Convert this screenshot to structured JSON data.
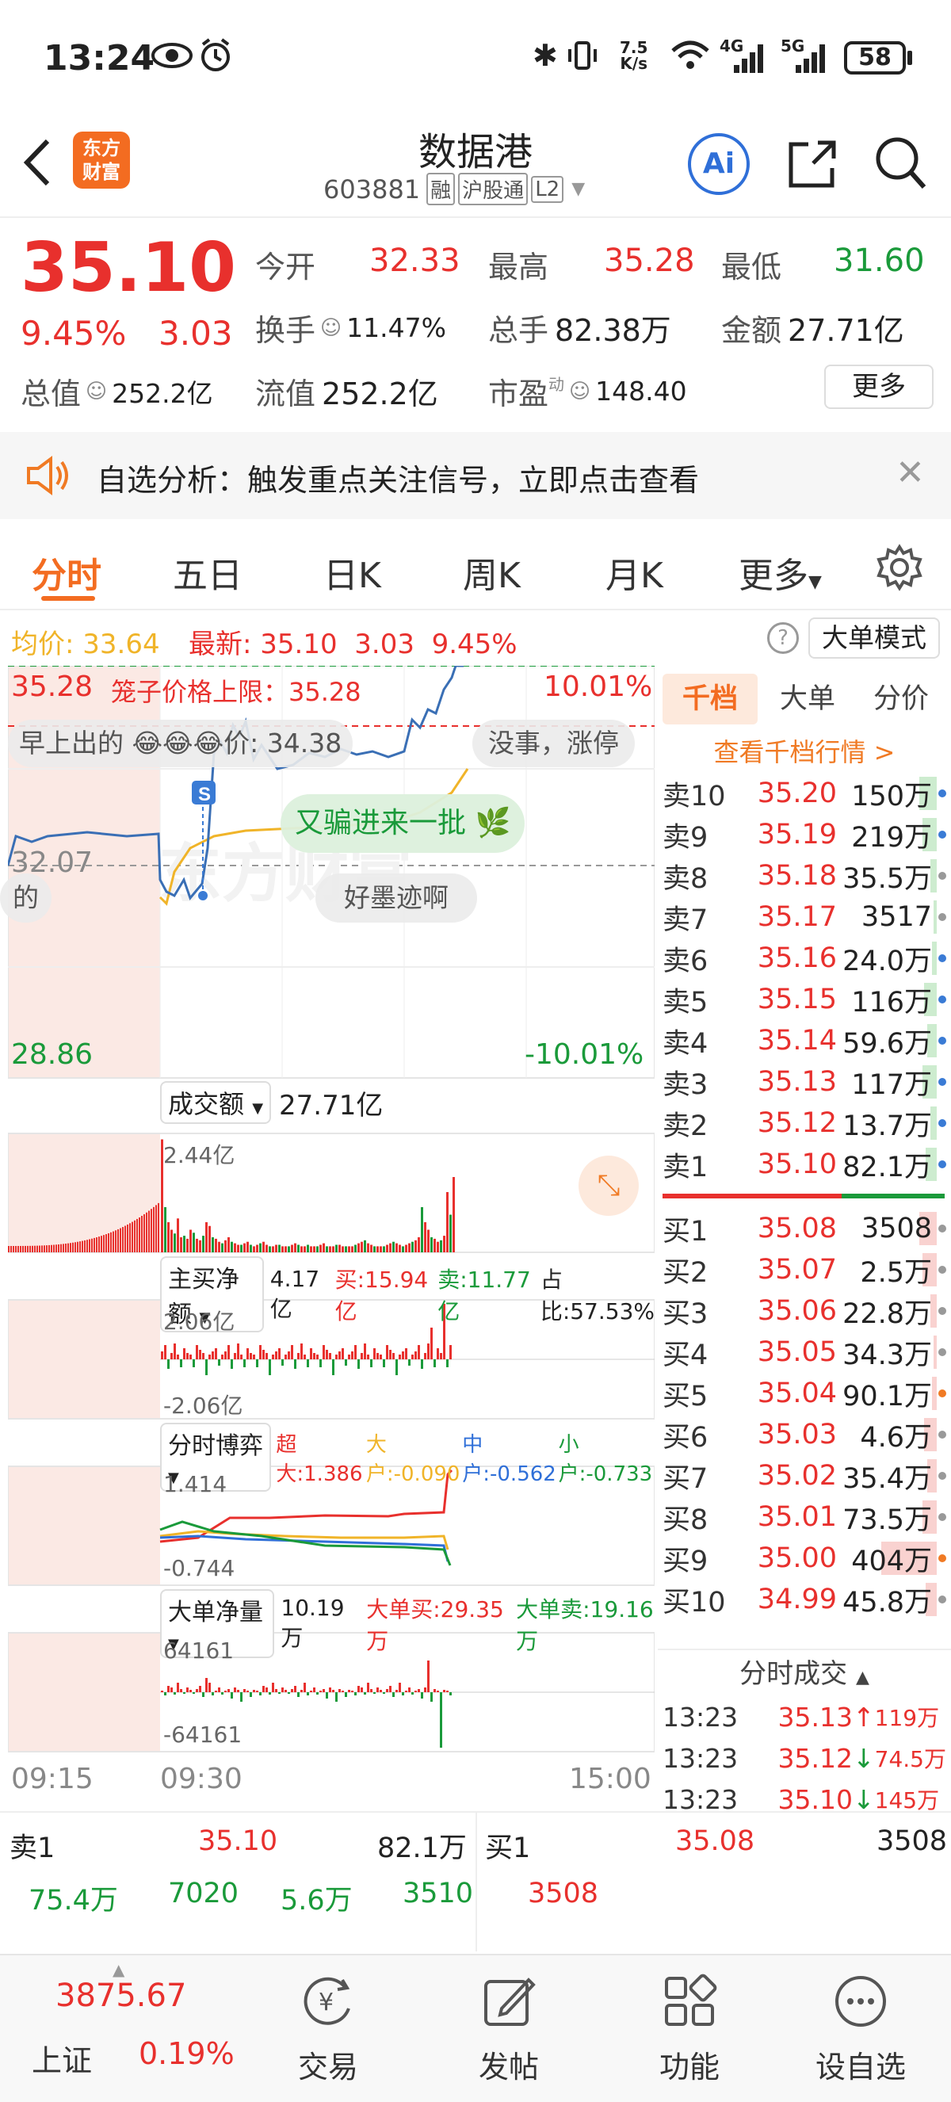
{
  "status": {
    "time": "13:24",
    "net_speed_top": "7.5",
    "net_speed_bottom": "K/s",
    "net1": "4G",
    "net2": "5G",
    "battery": "58"
  },
  "header": {
    "logo_line1": "东方",
    "logo_line2": "财富",
    "title": "数据港",
    "code": "603881",
    "badge1": "融",
    "badge2": "沪股通",
    "badge3": "L2",
    "ai_label": "Ai"
  },
  "quote": {
    "price": "35.10",
    "change_pct": "9.45%",
    "change": "3.03",
    "open_label": "今开",
    "open": "32.33",
    "high_label": "最高",
    "high": "35.28",
    "low_label": "最低",
    "low": "31.60",
    "turnover_label": "换手",
    "turnover": "11.47%",
    "volume_label": "总手",
    "volume": "82.38万",
    "amount_label": "金额",
    "amount": "27.71亿",
    "mktcap_label": "总值",
    "mktcap": "252.2亿",
    "float_label": "流值",
    "float": "252.2亿",
    "pe_label": "市盈",
    "pe_sup": "动",
    "pe": "148.40",
    "more_btn": "更多"
  },
  "notice": {
    "text": "自选分析：触发重点关注信号，立即点击查看"
  },
  "tabs": [
    "分时",
    "五日",
    "日K",
    "周K",
    "月K",
    "更多"
  ],
  "infoline": {
    "avg_label": "均价:",
    "avg": "33.64",
    "latest_label": "最新:",
    "latest": "35.10",
    "chg": "3.03",
    "pct": "9.45%",
    "mode_btn": "大单模式"
  },
  "chart": {
    "top_price": "35.28",
    "limit_text": "笼子价格上限：35.28",
    "top_pct": "10.01%",
    "prev_close": "32.07",
    "bottom_price": "28.86",
    "bottom_pct": "-10.01%",
    "bubble1_left": "早上出的",
    "bubble1_mid": "价",
    "bubble1_val": "34.38",
    "bubble2": "没事，涨停",
    "bubble3": "又骗进来一批",
    "bubble4": "好墨迹啊",
    "bubble5": "的",
    "s_marker": "S",
    "vol_label": "成交额",
    "vol_total": "27.71亿",
    "vol_max": "2.44亿",
    "net_label": "主买净额",
    "net_val": "4.17亿",
    "net_buy": "买:15.94亿",
    "net_sell": "卖:11.77亿",
    "net_ratio": "占比:57.53%",
    "net_max": "2.06亿",
    "net_min": "-2.06亿",
    "game_label": "分时博弈",
    "game_super": "超大:1.386",
    "game_big": "大户:-0.090",
    "game_mid": "中户:-0.562",
    "game_small": "小户:-0.733",
    "game_max": "1.414",
    "game_min": "-0.744",
    "bignet_label": "大单净量",
    "bignet_val": "10.19万",
    "bignet_buy": "大单买:29.35万",
    "bignet_sell": "大单卖:19.16万",
    "bignet_max": "64161",
    "bignet_min": "-64161",
    "t_start": "09:15",
    "t_open": "09:30",
    "t_end": "15:00",
    "colors": {
      "price": "#3a6fb5",
      "avg": "#f0b429",
      "up": "#e8302d",
      "down": "#1a9a3a"
    }
  },
  "book": {
    "tabs": [
      "千档",
      "大单",
      "分价"
    ],
    "link": "查看千档行情 >",
    "asks": [
      {
        "label": "卖10",
        "price": "35.20",
        "vol": "150万"
      },
      {
        "label": "卖9",
        "price": "35.19",
        "vol": "219万"
      },
      {
        "label": "卖8",
        "price": "35.18",
        "vol": "35.5万"
      },
      {
        "label": "卖7",
        "price": "35.17",
        "vol": "3517"
      },
      {
        "label": "卖6",
        "price": "35.16",
        "vol": "24.0万"
      },
      {
        "label": "卖5",
        "price": "35.15",
        "vol": "116万"
      },
      {
        "label": "卖4",
        "price": "35.14",
        "vol": "59.6万"
      },
      {
        "label": "卖3",
        "price": "35.13",
        "vol": "117万"
      },
      {
        "label": "卖2",
        "price": "35.12",
        "vol": "13.7万"
      },
      {
        "label": "卖1",
        "price": "35.10",
        "vol": "82.1万"
      }
    ],
    "bids": [
      {
        "label": "买1",
        "price": "35.08",
        "vol": "3508"
      },
      {
        "label": "买2",
        "price": "35.07",
        "vol": "2.5万"
      },
      {
        "label": "买3",
        "price": "35.06",
        "vol": "22.8万"
      },
      {
        "label": "买4",
        "price": "35.05",
        "vol": "34.3万"
      },
      {
        "label": "买5",
        "price": "35.04",
        "vol": "90.1万"
      },
      {
        "label": "买6",
        "price": "35.03",
        "vol": "4.6万"
      },
      {
        "label": "买7",
        "price": "35.02",
        "vol": "35.4万"
      },
      {
        "label": "买8",
        "price": "35.01",
        "vol": "73.5万"
      },
      {
        "label": "买9",
        "price": "35.00",
        "vol": "404万"
      },
      {
        "label": "买10",
        "price": "34.99",
        "vol": "45.8万"
      }
    ],
    "ticks_title": "分时成交",
    "ticks": [
      {
        "time": "13:23",
        "price": "35.13",
        "dir": "↑",
        "vol": "119万"
      },
      {
        "time": "13:23",
        "price": "35.12",
        "dir": "↓",
        "vol": "74.5万"
      },
      {
        "time": "13:23",
        "price": "35.10",
        "dir": "↓",
        "vol": "145万"
      }
    ]
  },
  "bottom_quote": {
    "ask1_label": "卖1",
    "ask1_price": "35.10",
    "ask1_vol": "82.1万",
    "bid1_label": "买1",
    "bid1_price": "35.08",
    "bid1_vol": "3508",
    "ask_queue": [
      "75.4万",
      "7020",
      "5.6万",
      "3510"
    ],
    "bid_queue": [
      "3508"
    ]
  },
  "bottomnav": {
    "index_value": "3875.67",
    "index_name": "上证",
    "index_pct": "0.19%",
    "items": [
      "交易",
      "发帖",
      "功能",
      "设自选"
    ]
  }
}
